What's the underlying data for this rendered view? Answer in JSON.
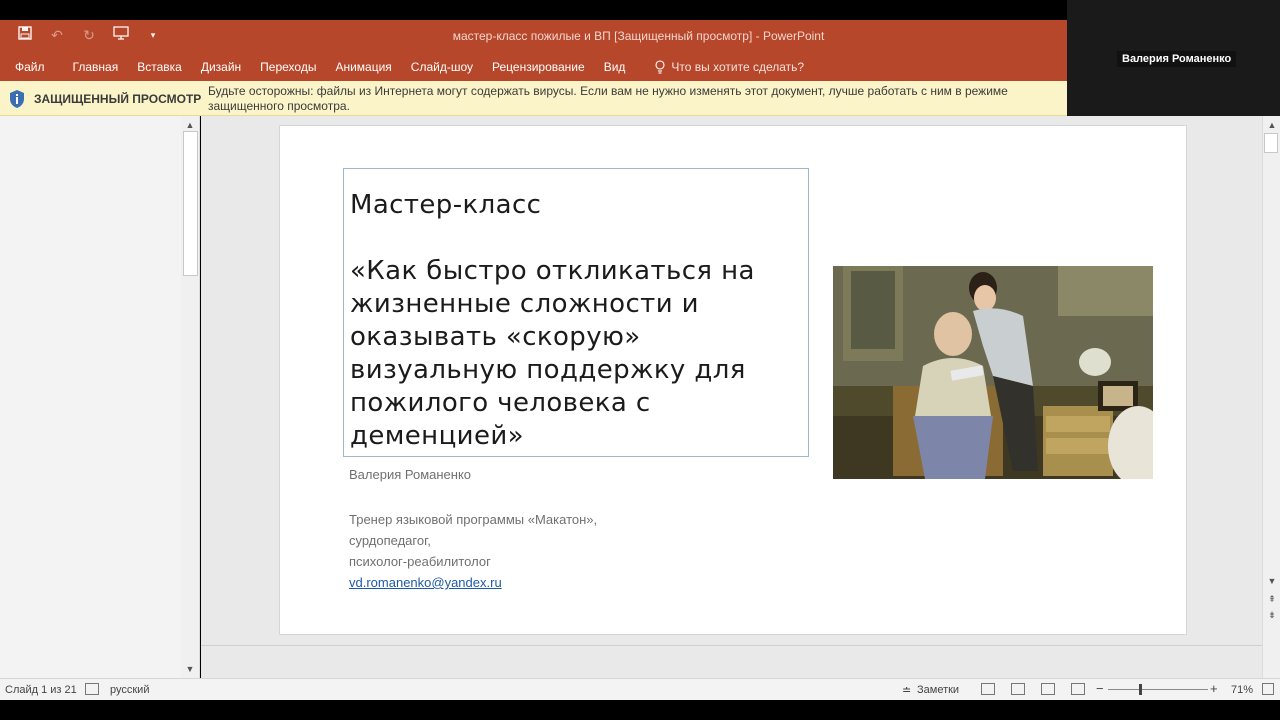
{
  "window": {
    "title": "мастер-класс пожилые и ВП [Защищенный просмотр]  -  PowerPoint"
  },
  "ribbon": {
    "tabs": [
      "Файл",
      "Главная",
      "Вставка",
      "Дизайн",
      "Переходы",
      "Анимация",
      "Слайд-шоу",
      "Рецензирование",
      "Вид"
    ],
    "tell_me": "Что вы хотите сделать?"
  },
  "protected_view": {
    "title": "ЗАЩИЩЕННЫЙ ПРОСМОТР",
    "message": "Будьте осторожны: файлы из Интернета могут содержать вирусы. Если вам не нужно изменять этот документ, лучше работать с ним в режиме защищенного просмотра."
  },
  "video": {
    "participant_name": "Валерия Романенко"
  },
  "slide": {
    "title": "Мастер-класс\n\n «Как быстро откликаться на жизненные сложности и оказывать «скорую» визуальную поддержку для пожилого человека с деменцией»",
    "author": "Валерия Романенко",
    "info_lines": [
      "Тренер языковой программы «Макатон»,",
      "сурдопедагог,",
      "психолог-реабилитолог"
    ],
    "email": "vd.romanenko@yandex.ru"
  },
  "status": {
    "slide_counter": "Слайд 1 из 21",
    "language": "русский",
    "notes": "Заметки",
    "zoom": "71%"
  },
  "colors": {
    "ribbon": "#b7472a",
    "protected_bar": "#fbf4c8",
    "link": "#1e5aa8"
  }
}
